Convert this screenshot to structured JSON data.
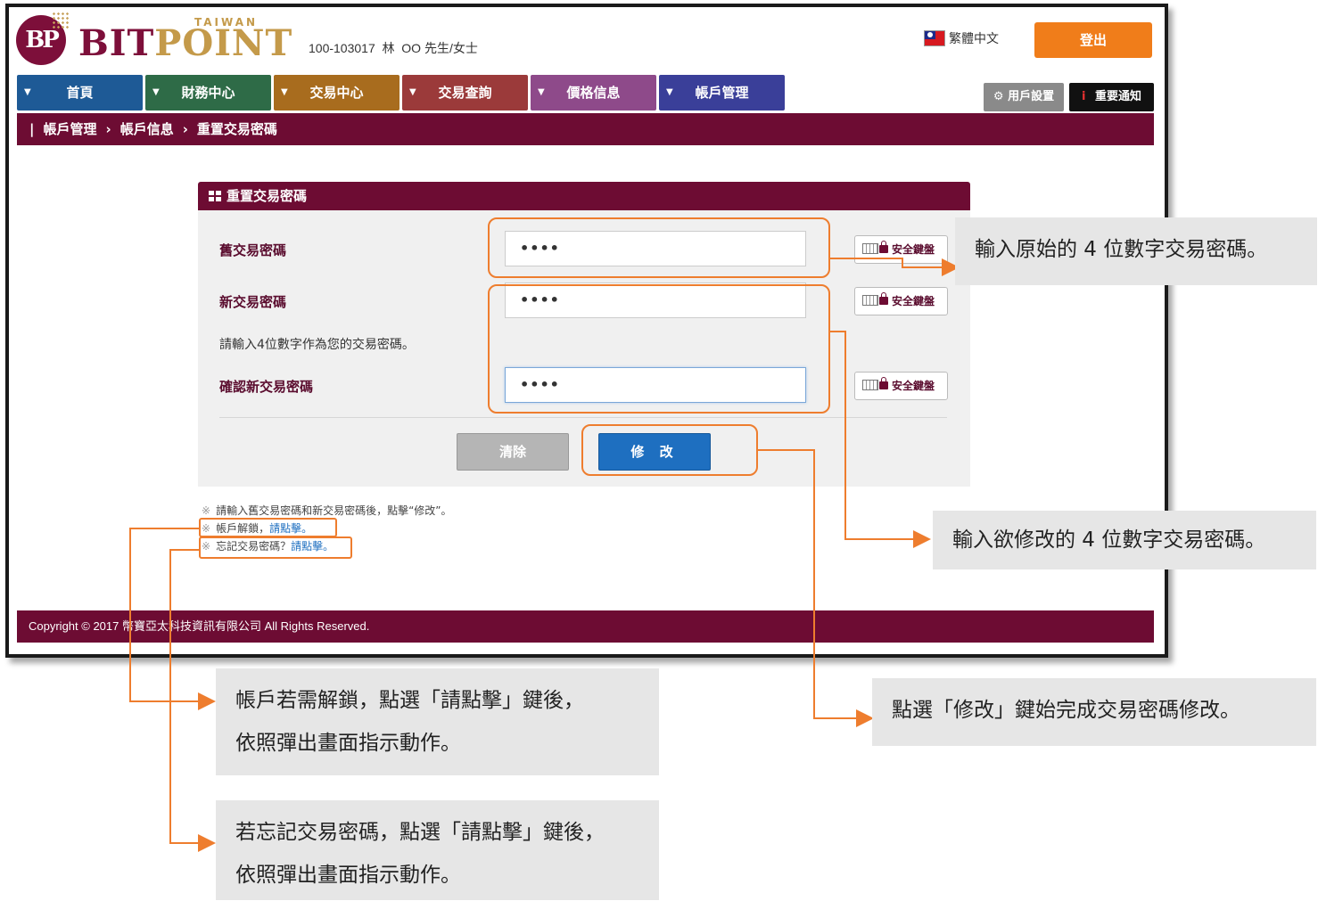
{
  "header": {
    "logo_text_main": "BIT",
    "logo_text_accent": "POINT",
    "logo_region": "TAIWAN",
    "logo_monogram": "BP",
    "user_info": "100-103017  林  OO 先生/女士",
    "language": "繁體中文",
    "logout_label": "登出",
    "user_settings_label": "用戶設置",
    "important_notice_label": "重要通知"
  },
  "nav": {
    "items": [
      {
        "label": "首頁",
        "color": "#1e5a96"
      },
      {
        "label": "財務中心",
        "color": "#2e6b47"
      },
      {
        "label": "交易中心",
        "color": "#a86c1e"
      },
      {
        "label": "交易查詢",
        "color": "#9b3a3a"
      },
      {
        "label": "價格信息",
        "color": "#8e4a8a"
      },
      {
        "label": "帳戶管理",
        "color": "#3a3f99"
      }
    ]
  },
  "breadcrumb": {
    "items": [
      "帳戶管理",
      "帳戶信息",
      "重置交易密碼"
    ],
    "separator": "›"
  },
  "form": {
    "title": "重置交易密碼",
    "old_password_label": "舊交易密碼",
    "old_password_value": "••••",
    "new_password_label": "新交易密碼",
    "new_password_value": "••••",
    "hint": "請輸入4位數字作為您的交易密碼。",
    "confirm_password_label": "確認新交易密碼",
    "confirm_password_value": "••••",
    "keyboard_button_label": "安全鍵盤",
    "clear_label": "清除",
    "modify_label": "修 改"
  },
  "notes": [
    {
      "mark": "※",
      "text": "請輸入舊交易密碼和新交易密碼後，點擊“修改”。",
      "link": ""
    },
    {
      "mark": "※",
      "text": "帳戶解鎖，",
      "link": "請點擊。"
    },
    {
      "mark": "※",
      "text": "忘記交易密碼？",
      "link": "請點擊。"
    }
  ],
  "footer": {
    "copyright": "Copyright © 2017 幣寶亞太科技資訊有限公司 All Rights Reserved."
  },
  "annotations": {
    "old_password": "輸入原始的 4 位數字交易密碼。",
    "new_password": "輸入欲修改的 4 位數字交易密碼。",
    "modify": "點選「修改」鍵始完成交易密碼修改。",
    "unlock_line1": "帳戶若需解鎖，點選「請點擊」鍵後，",
    "unlock_line2": "依照彈出畫面指示動作。",
    "forgot_line1": "若忘記交易密碼，點選「請點擊」鍵後，",
    "forgot_line2": "依照彈出畫面指示動作。",
    "accent_color": "#ee7d2e"
  },
  "colors": {
    "brand_maroon": "#6d0c33",
    "logout_orange": "#f07d1a",
    "modify_blue": "#1e6fc0"
  }
}
